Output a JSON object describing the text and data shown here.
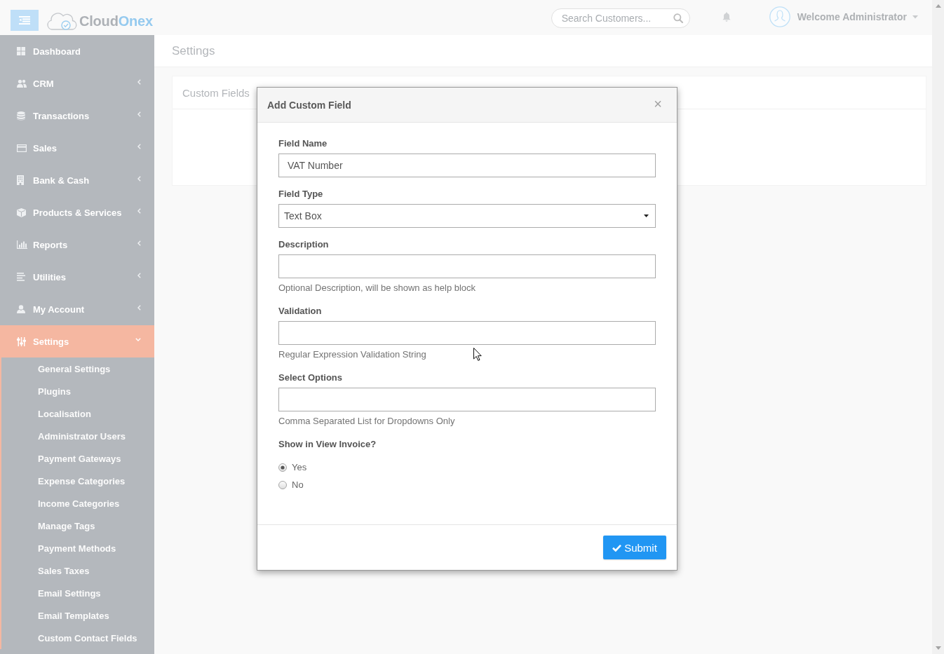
{
  "header": {
    "logo_words": [
      "Cloud",
      "Onex"
    ],
    "search": {
      "placeholder": "Search Customers..."
    },
    "user": {
      "greeting": "Welcome Administrator"
    }
  },
  "sidebar": {
    "items": [
      {
        "kind": "link",
        "label": "Dashboard",
        "selected": false
      },
      {
        "kind": "menu",
        "label": "CRM",
        "selected": false,
        "expanded": false
      },
      {
        "kind": "menu",
        "label": "Transactions",
        "selected": false,
        "expanded": false
      },
      {
        "kind": "menu",
        "label": "Sales",
        "selected": false,
        "expanded": false
      },
      {
        "kind": "menu",
        "label": "Bank & Cash",
        "selected": false,
        "expanded": false
      },
      {
        "kind": "menu",
        "label": "Products & Services",
        "selected": false,
        "expanded": false
      },
      {
        "kind": "menu",
        "label": "Reports",
        "selected": false,
        "expanded": false
      },
      {
        "kind": "menu",
        "label": "Utilities",
        "selected": false,
        "expanded": false
      },
      {
        "kind": "menu",
        "label": "My Account",
        "selected": false,
        "expanded": false
      },
      {
        "kind": "menu",
        "label": "Settings",
        "selected": true,
        "expanded": true,
        "children": [
          {
            "label": "General Settings",
            "selected": false
          },
          {
            "label": "Plugins",
            "selected": false
          },
          {
            "label": "Localisation",
            "selected": false
          },
          {
            "label": "Administrator Users",
            "selected": false
          },
          {
            "label": "Payment Gateways",
            "selected": false
          },
          {
            "label": "Expense Categories",
            "selected": false
          },
          {
            "label": "Income Categories",
            "selected": false
          },
          {
            "label": "Manage Tags",
            "selected": false
          },
          {
            "label": "Payment Methods",
            "selected": false
          },
          {
            "label": "Sales Taxes",
            "selected": false
          },
          {
            "label": "Email Settings",
            "selected": false
          },
          {
            "label": "Email Templates",
            "selected": false
          },
          {
            "label": "Custom Contact Fields",
            "selected": false
          }
        ]
      }
    ]
  },
  "page": {
    "title": "Settings",
    "card": {
      "title": "Custom Fields"
    }
  },
  "modal": {
    "title": "Add Custom Field",
    "close": "×",
    "fields": [
      {
        "kind": "text",
        "label": "Field Name",
        "value": "VAT Number"
      },
      {
        "kind": "select",
        "label": "Field Type",
        "value": "Text Box"
      },
      {
        "kind": "text",
        "label": "Description",
        "help": "Optional Description, will be shown as help block"
      },
      {
        "kind": "text",
        "label": "Validation",
        "help": "Regular Expression Validation String"
      },
      {
        "kind": "text",
        "label": "Select Options",
        "help": "Comma Separated List for Dropdowns Only"
      },
      {
        "kind": "radio",
        "label": "Show in View Invoice?",
        "options": [
          {
            "label": "Yes",
            "selected": true
          },
          {
            "label": "No",
            "selected": false
          }
        ]
      }
    ],
    "submit": "Submit"
  }
}
